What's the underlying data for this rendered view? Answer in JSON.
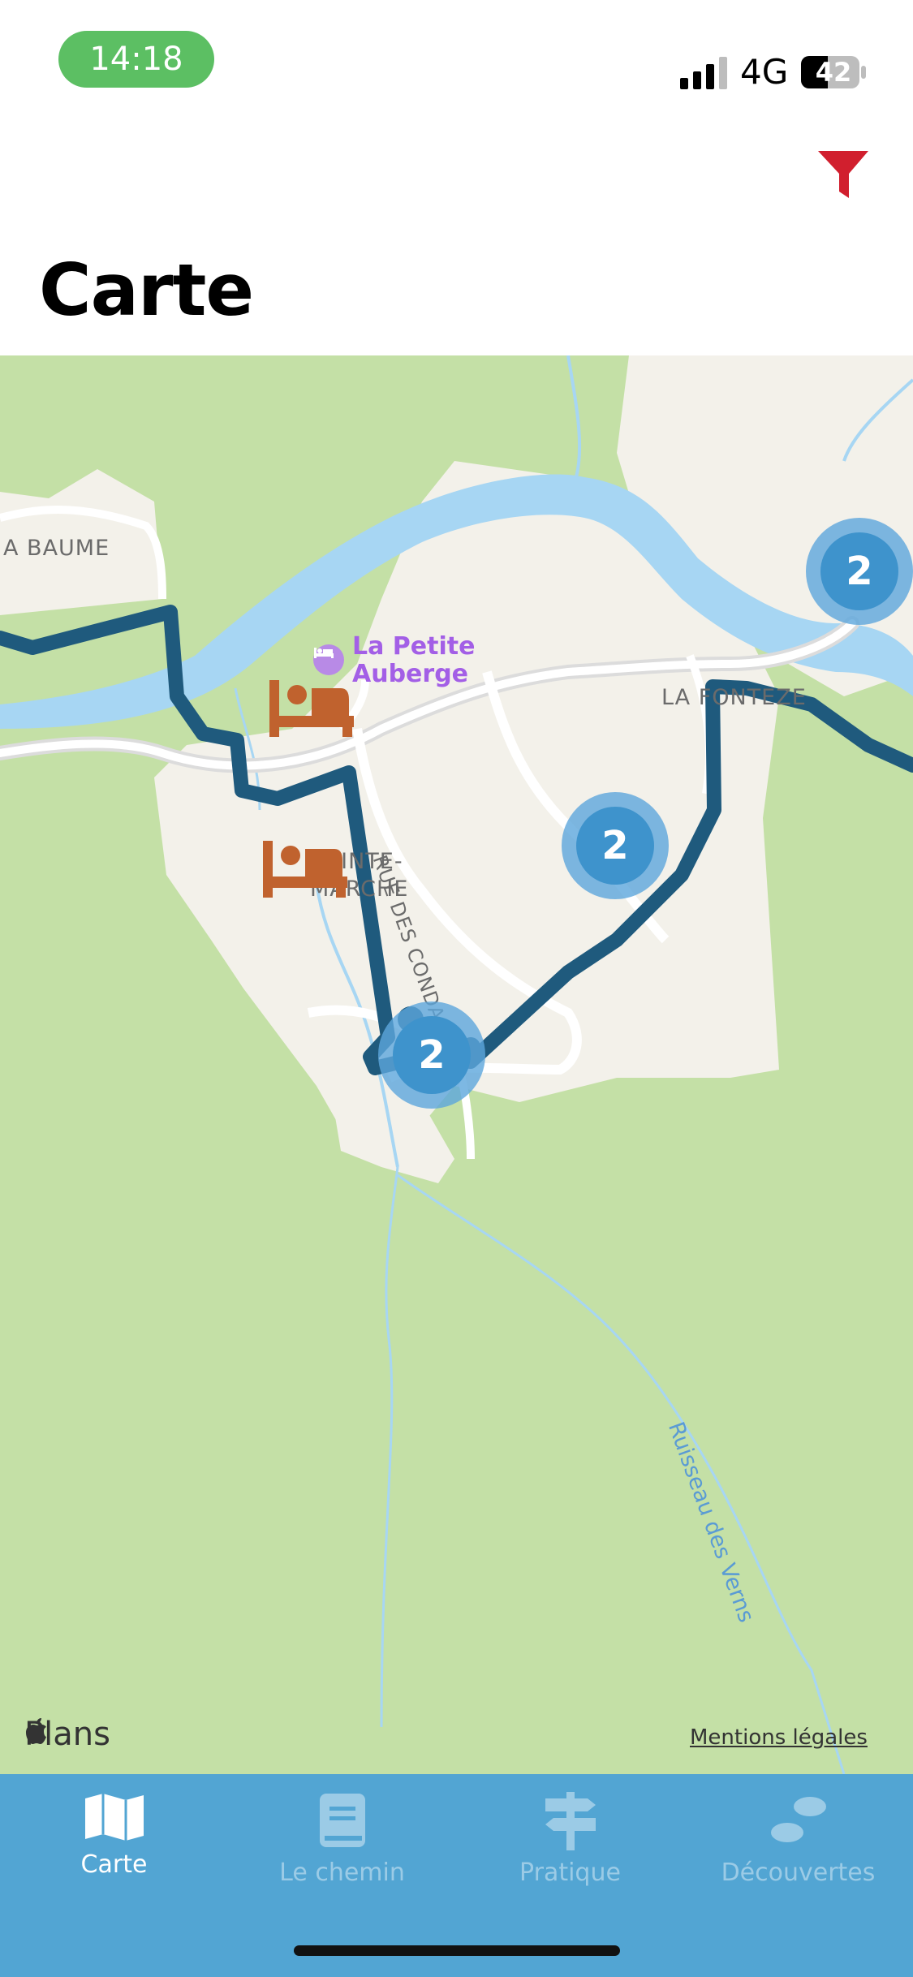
{
  "status_bar": {
    "time": "14:18",
    "network": "4G",
    "battery": "42"
  },
  "header": {
    "title": "Carte",
    "filter_icon": "filter-icon"
  },
  "map": {
    "labels": {
      "place_baume": "A BAUME",
      "place_fontete": "LA FONTEZE",
      "place_sainte_marche_1": "SAINTE-",
      "place_sainte_marche_2": "MARCHE",
      "street_condamnes": "RUE DES CONDAMNES",
      "stream_verns": "Ruisseau des Verns"
    },
    "poi": {
      "name_line1": "La Petite",
      "name_line2": "Auberge",
      "icon": "bed-icon"
    },
    "clusters": [
      "2",
      "2",
      "2"
    ],
    "attribution": "Plans",
    "legal": "Mentions légales",
    "colors": {
      "route": "#1f5a7d",
      "cluster": "#3e93cc",
      "lodging": "#c0622e",
      "water": "#a7d6f3"
    }
  },
  "tabs": [
    {
      "label": "Carte",
      "icon": "map-icon",
      "active": true
    },
    {
      "label": "Le chemin",
      "icon": "book-icon",
      "active": false
    },
    {
      "label": "Pratique",
      "icon": "signpost-icon",
      "active": false
    },
    {
      "label": "Découvertes",
      "icon": "footprints-icon",
      "active": false
    }
  ]
}
